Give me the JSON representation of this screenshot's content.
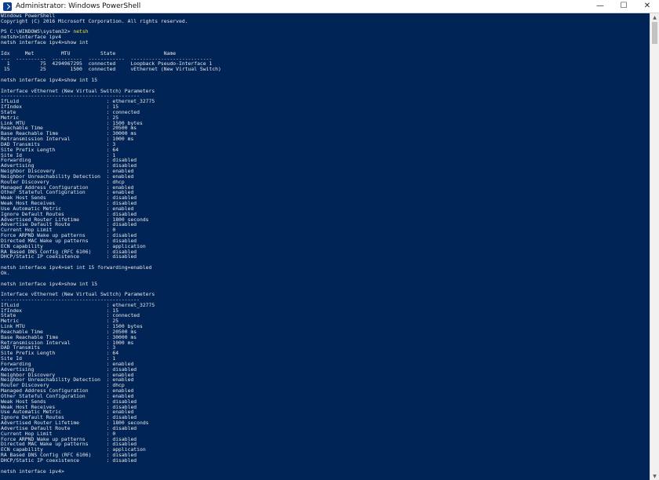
{
  "window": {
    "title": "Administrator: Windows PowerShell",
    "controls": {
      "minimize": "—",
      "maximize": "☐",
      "close": "✕"
    }
  },
  "terminal": {
    "lines": [
      "Windows PowerShell",
      "Copyright (C) 2016 Microsoft Corporation. All rights reserved.",
      "",
      "PS C:\\WINDOWS\\system32> netsh",
      "netsh>interface ipv4",
      "netsh interface ipv4>show int",
      "",
      "Idx     Met         MTU          State                Name",
      "---  ----------  ----------  ------------  ---------------------------",
      "  1          75  4294967295  connected     Loopback Pseudo-Interface 1",
      " 15          25        1500  connected     vEthernet (New Virtual Switch)",
      "",
      "netsh interface ipv4>show int 15",
      "",
      "Interface vEthernet (New Virtual Switch) Parameters",
      "----------------------------------------------",
      "IfLuid                             : ethernet_32775",
      "IfIndex                            : 15",
      "State                              : connected",
      "Metric                             : 25",
      "Link MTU                           : 1500 bytes",
      "Reachable Time                     : 20500 ms",
      "Base Reachable Time                : 30000 ms",
      "Retransmission Interval            : 1000 ms",
      "DAD Transmits                      : 3",
      "Site Prefix Length                 : 64",
      "Site Id                            : 1",
      "Forwarding                         : disabled",
      "Advertising                        : disabled",
      "Neighbor Discovery                 : enabled",
      "Neighbor Unreachability Detection  : enabled",
      "Router Discovery                   : dhcp",
      "Managed Address Configuration      : enabled",
      "Other Stateful Configuration       : enabled",
      "Weak Host Sends                    : disabled",
      "Weak Host Receives                 : disabled",
      "Use Automatic Metric               : enabled",
      "Ignore Default Routes              : disabled",
      "Advertised Router Lifetime         : 1800 seconds",
      "Advertise Default Route            : disabled",
      "Current Hop Limit                  : 0",
      "Force ARPND Wake up patterns       : disabled",
      "Directed MAC Wake up patterns      : disabled",
      "ECN capability                     : application",
      "RA Based DNS Config (RFC 6106)     : disabled",
      "DHCP/Static IP coexistence         : disabled",
      "",
      "netsh interface ipv4>set int 15 forwarding=enabled",
      "Ok.",
      "",
      "netsh interface ipv4>show int 15",
      "",
      "Interface vEthernet (New Virtual Switch) Parameters",
      "----------------------------------------------",
      "IfLuid                             : ethernet_32775",
      "IfIndex                            : 15",
      "State                              : connected",
      "Metric                             : 25",
      "Link MTU                           : 1500 bytes",
      "Reachable Time                     : 20500 ms",
      "Base Reachable Time                : 30000 ms",
      "Retransmission Interval            : 1000 ms",
      "DAD Transmits                      : 3",
      "Site Prefix Length                 : 64",
      "Site Id                            : 1",
      "Forwarding                         : enabled",
      "Advertising                        : disabled",
      "Neighbor Discovery                 : enabled",
      "Neighbor Unreachability Detection  : enabled",
      "Router Discovery                   : dhcp",
      "Managed Address Configuration      : enabled",
      "Other Stateful Configuration       : enabled",
      "Weak Host Sends                    : disabled",
      "Weak Host Receives                 : disabled",
      "Use Automatic Metric               : enabled",
      "Ignore Default Routes              : disabled",
      "Advertised Router Lifetime         : 1800 seconds",
      "Advertise Default Route            : disabled",
      "Current Hop Limit                  : 0",
      "Force ARPND Wake up patterns       : disabled",
      "Directed MAC Wake up patterns      : disabled",
      "ECN capability                     : application",
      "RA Based DNS Config (RFC 6106)     : disabled",
      "DHCP/Static IP coexistence         : disabled",
      "",
      "netsh interface ipv4>"
    ],
    "prompt_command": "netsh"
  },
  "colors": {
    "background": "#012456",
    "text": "#e8e8e8",
    "command_highlight": "#f0e04a",
    "titlebar": "#ffffff"
  },
  "icons": {
    "app": "powershell-icon",
    "minimize": "minimize-icon",
    "maximize": "maximize-icon",
    "close": "close-icon"
  }
}
